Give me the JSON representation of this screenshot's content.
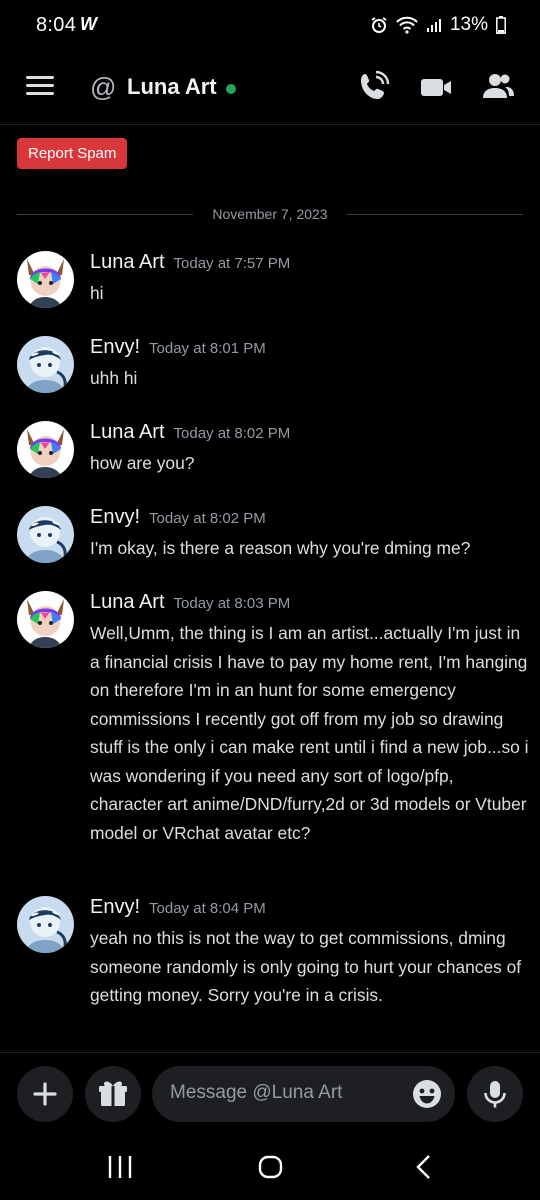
{
  "status_bar": {
    "time": "8:04",
    "battery": "13%"
  },
  "header": {
    "at_symbol": "@",
    "title": "Luna Art"
  },
  "report_spam": "Report Spam",
  "date_divider": "November 7, 2023",
  "messages": [
    {
      "author": "Luna Art",
      "timestamp": "Today at 7:57 PM",
      "content": "hi"
    },
    {
      "author": "Envy!",
      "timestamp": "Today at 8:01 PM",
      "content": "uhh hi"
    },
    {
      "author": "Luna Art",
      "timestamp": "Today at 8:02 PM",
      "content": "how are you?"
    },
    {
      "author": "Envy!",
      "timestamp": "Today at 8:02 PM",
      "content": "I'm okay, is there a reason why you're dming me?"
    },
    {
      "author": "Luna Art",
      "timestamp": "Today at 8:03 PM",
      "content": "Well,Umm, the thing is I am an artist...actually I'm just in a financial crisis I have to pay my home rent, I'm hanging on therefore I'm in an hunt for some emergency commissions I recently got off from my job so drawing stuff is the only i can make rent until i find a new job...so i was wondering if you need any sort of logo/pfp, character art anime/DND/furry,2d or 3d models or Vtuber model or VRchat avatar etc?"
    },
    {
      "author": "Envy!",
      "timestamp": "Today at 8:04 PM",
      "content": "yeah no this is not the way to get commissions, dming someone randomly is only going to hurt your chances of getting money. Sorry you're in a crisis."
    }
  ],
  "composer": {
    "placeholder": "Message @Luna Art"
  },
  "colors": {
    "online": "#23a55a",
    "report_spam": "#da373c",
    "background": "#000000"
  }
}
